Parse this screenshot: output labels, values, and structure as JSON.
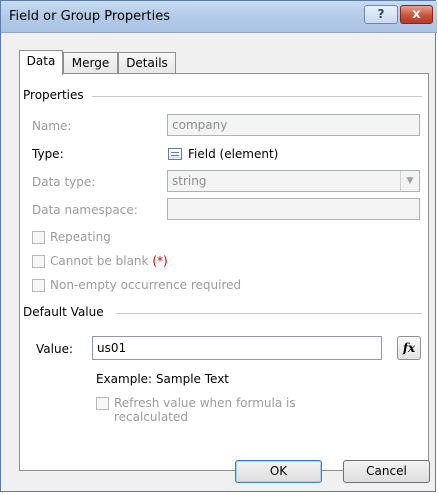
{
  "window": {
    "title": "Field or Group Properties",
    "help_glyph": "?",
    "close_glyph": "x"
  },
  "tabs": [
    {
      "label": "Data",
      "active": true
    },
    {
      "label": "Merge",
      "active": false
    },
    {
      "label": "Details",
      "active": false
    }
  ],
  "properties": {
    "section_label": "Properties",
    "name_label": "Name:",
    "name_value": "company",
    "type_label": "Type:",
    "type_value": "Field (element)",
    "data_type_label": "Data type:",
    "data_type_value": "string",
    "data_namespace_label": "Data namespace:",
    "data_namespace_value": "",
    "repeating_label": "Repeating",
    "cannot_be_blank_label": "Cannot be blank",
    "cannot_be_blank_marker": "(*)",
    "non_empty_label": "Non-empty occurrence required"
  },
  "default_value": {
    "section_label": "Default Value",
    "value_label": "Value:",
    "value": "us01",
    "fx_label": "fx",
    "example_text": "Example: Sample Text",
    "refresh_label_line1": "Refresh value when formula is",
    "refresh_label_line2": "recalculated"
  },
  "buttons": {
    "ok": "OK",
    "cancel": "Cancel"
  },
  "colors": {
    "required_marker": "#d00000",
    "title_bar": "#b4cbe8",
    "close_button": "#c8523b"
  }
}
